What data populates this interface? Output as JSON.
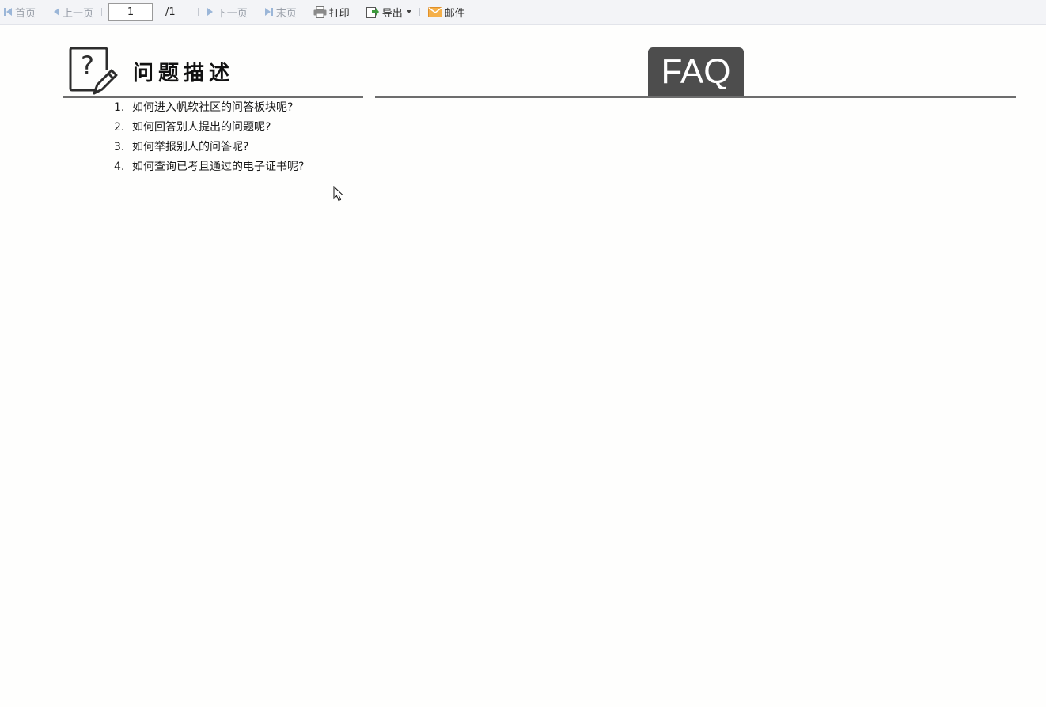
{
  "toolbar": {
    "first_label": "首页",
    "prev_label": "上一页",
    "page_input_value": "1",
    "page_total": "/1",
    "next_label": "下一页",
    "last_label": "末页",
    "print_label": "打印",
    "export_label": "导出",
    "mail_label": "邮件"
  },
  "report": {
    "section_title": "问题描述",
    "faq_badge": "FAQ",
    "questions": [
      {
        "num": "1.",
        "text": "如何进入帆软社区的问答板块呢?"
      },
      {
        "num": "2.",
        "text": "如何回答别人提出的问题呢?"
      },
      {
        "num": "3.",
        "text": "如何举报别人的问答呢?"
      },
      {
        "num": "4.",
        "text": "如何查询已考且通过的电子证书呢?"
      }
    ]
  },
  "icons": {
    "first": "first-page-icon",
    "prev": "prev-page-icon",
    "next": "next-page-icon",
    "last": "last-page-icon",
    "print": "printer-icon",
    "export": "export-icon",
    "mail": "mail-icon",
    "question": "question-edit-icon"
  },
  "colors": {
    "nav_icon": "#9bb6d8",
    "export_green": "#3c9a3c",
    "mail_orange": "#f2a33a",
    "badge_bg": "#4d4d4d"
  }
}
